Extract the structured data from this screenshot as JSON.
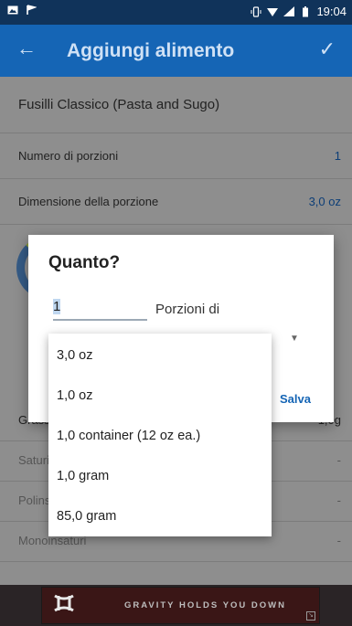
{
  "status_bar": {
    "time": "19:04"
  },
  "app_bar": {
    "back": "←",
    "title": "Aggiungi alimento",
    "confirm": "✓"
  },
  "food": {
    "name": "Fusilli Classico (Pasta and Sugo)"
  },
  "rows": {
    "portions_label": "Numero di porzioni",
    "portions_value": "1",
    "portion_size_label": "Dimensione della porzione",
    "portion_size_value": "3,0 oz"
  },
  "nutrients": {
    "fats_label": "Grassi",
    "fats_value": "1,0g",
    "saturated_label": "Saturi",
    "saturated_value": "-",
    "polyunsaturated_label": "Polinsaturi",
    "polyunsaturated_value": "-",
    "monounsaturated_label": "Monoinsaturi",
    "monounsaturated_value": "-"
  },
  "dialog": {
    "title": "Quanto?",
    "quantity_value": "1",
    "portions_of": "Porzioni di",
    "save": "Salva"
  },
  "dropdown": {
    "options": [
      "3,0 oz",
      "1,0 oz",
      "1,0 container (12 oz ea.)",
      "1,0 gram",
      "85,0 gram"
    ]
  },
  "ad": {
    "slogan": "GRAVITY HOLDS YOU DOWN"
  }
}
